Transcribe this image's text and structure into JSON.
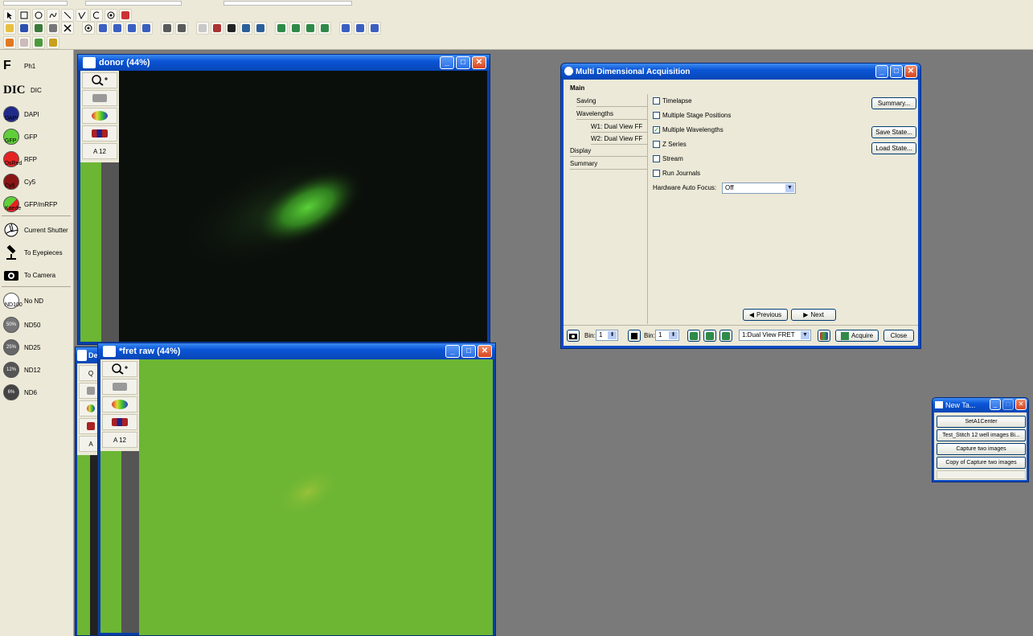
{
  "palette": {
    "items": [
      {
        "label": "Ph1",
        "sub": ""
      },
      {
        "label": "DIC",
        "sub": ""
      },
      {
        "label": "DAPI",
        "sub": "DAPI",
        "color": "#1f2a8a"
      },
      {
        "label": "GFP",
        "sub": "GFP",
        "color": "#5fcf3a"
      },
      {
        "label": "RFP",
        "sub": "DsRed",
        "color": "#e52222"
      },
      {
        "label": "Cy5",
        "sub": "Cy5",
        "color": "#8a1515"
      },
      {
        "label": "GFP/mRFP",
        "sub": "Kaede",
        "color": "#d33"
      },
      {
        "label": "Current Shutter",
        "sub": ""
      },
      {
        "label": "To Eyepieces",
        "sub": ""
      },
      {
        "label": "To Camera",
        "sub": ""
      },
      {
        "label": "No ND",
        "sub": "ND100"
      },
      {
        "label": "ND50",
        "badge": "50%"
      },
      {
        "label": "ND25",
        "badge": "25%"
      },
      {
        "label": "ND12",
        "badge": "12%"
      },
      {
        "label": "ND6",
        "badge": "6%"
      }
    ]
  },
  "windows": {
    "donor": {
      "title": "donor (44%)"
    },
    "fret": {
      "title": "*fret raw (44%)"
    },
    "behind": {
      "title": "De"
    }
  },
  "mda": {
    "title": "Multi Dimensional Acquisition",
    "main_tab": "Main",
    "nav": [
      "Saving",
      "Wavelengths",
      "W1: Dual View FF",
      "W2: Dual View FF",
      "Display",
      "Summary"
    ],
    "options": [
      {
        "label": "Timelapse",
        "checked": false
      },
      {
        "label": "Multiple Stage Positions",
        "checked": false
      },
      {
        "label": "Multiple Wavelengths",
        "checked": true
      },
      {
        "label": "Z Series",
        "checked": false
      },
      {
        "label": "Stream",
        "checked": false
      },
      {
        "label": "Run Journals",
        "checked": false
      }
    ],
    "autofocus_label": "Hardware Auto Focus:",
    "autofocus_value": "Off",
    "summary_btn": "Summary...",
    "save_state_btn": "Save State...",
    "load_state_btn": "Load State...",
    "previous_btn": "Previous",
    "next_btn": "Next",
    "bin_label": "Bin:",
    "bin1_value": "1",
    "bin2_value": "1",
    "illumination_value": "1:Dual View FRET",
    "acquire_btn": "Acquire",
    "close_btn": "Close"
  },
  "newtask": {
    "title": "New Ta...",
    "buttons": [
      "SetA1Center",
      "Test_Stitch 12 well images Bi...",
      "Capture two images",
      "Copy of Capture two images"
    ]
  },
  "colors": {
    "fret_field": "#6cb633",
    "donor_field": "#0b0f0b",
    "xp_blue": "#0a55d6"
  }
}
